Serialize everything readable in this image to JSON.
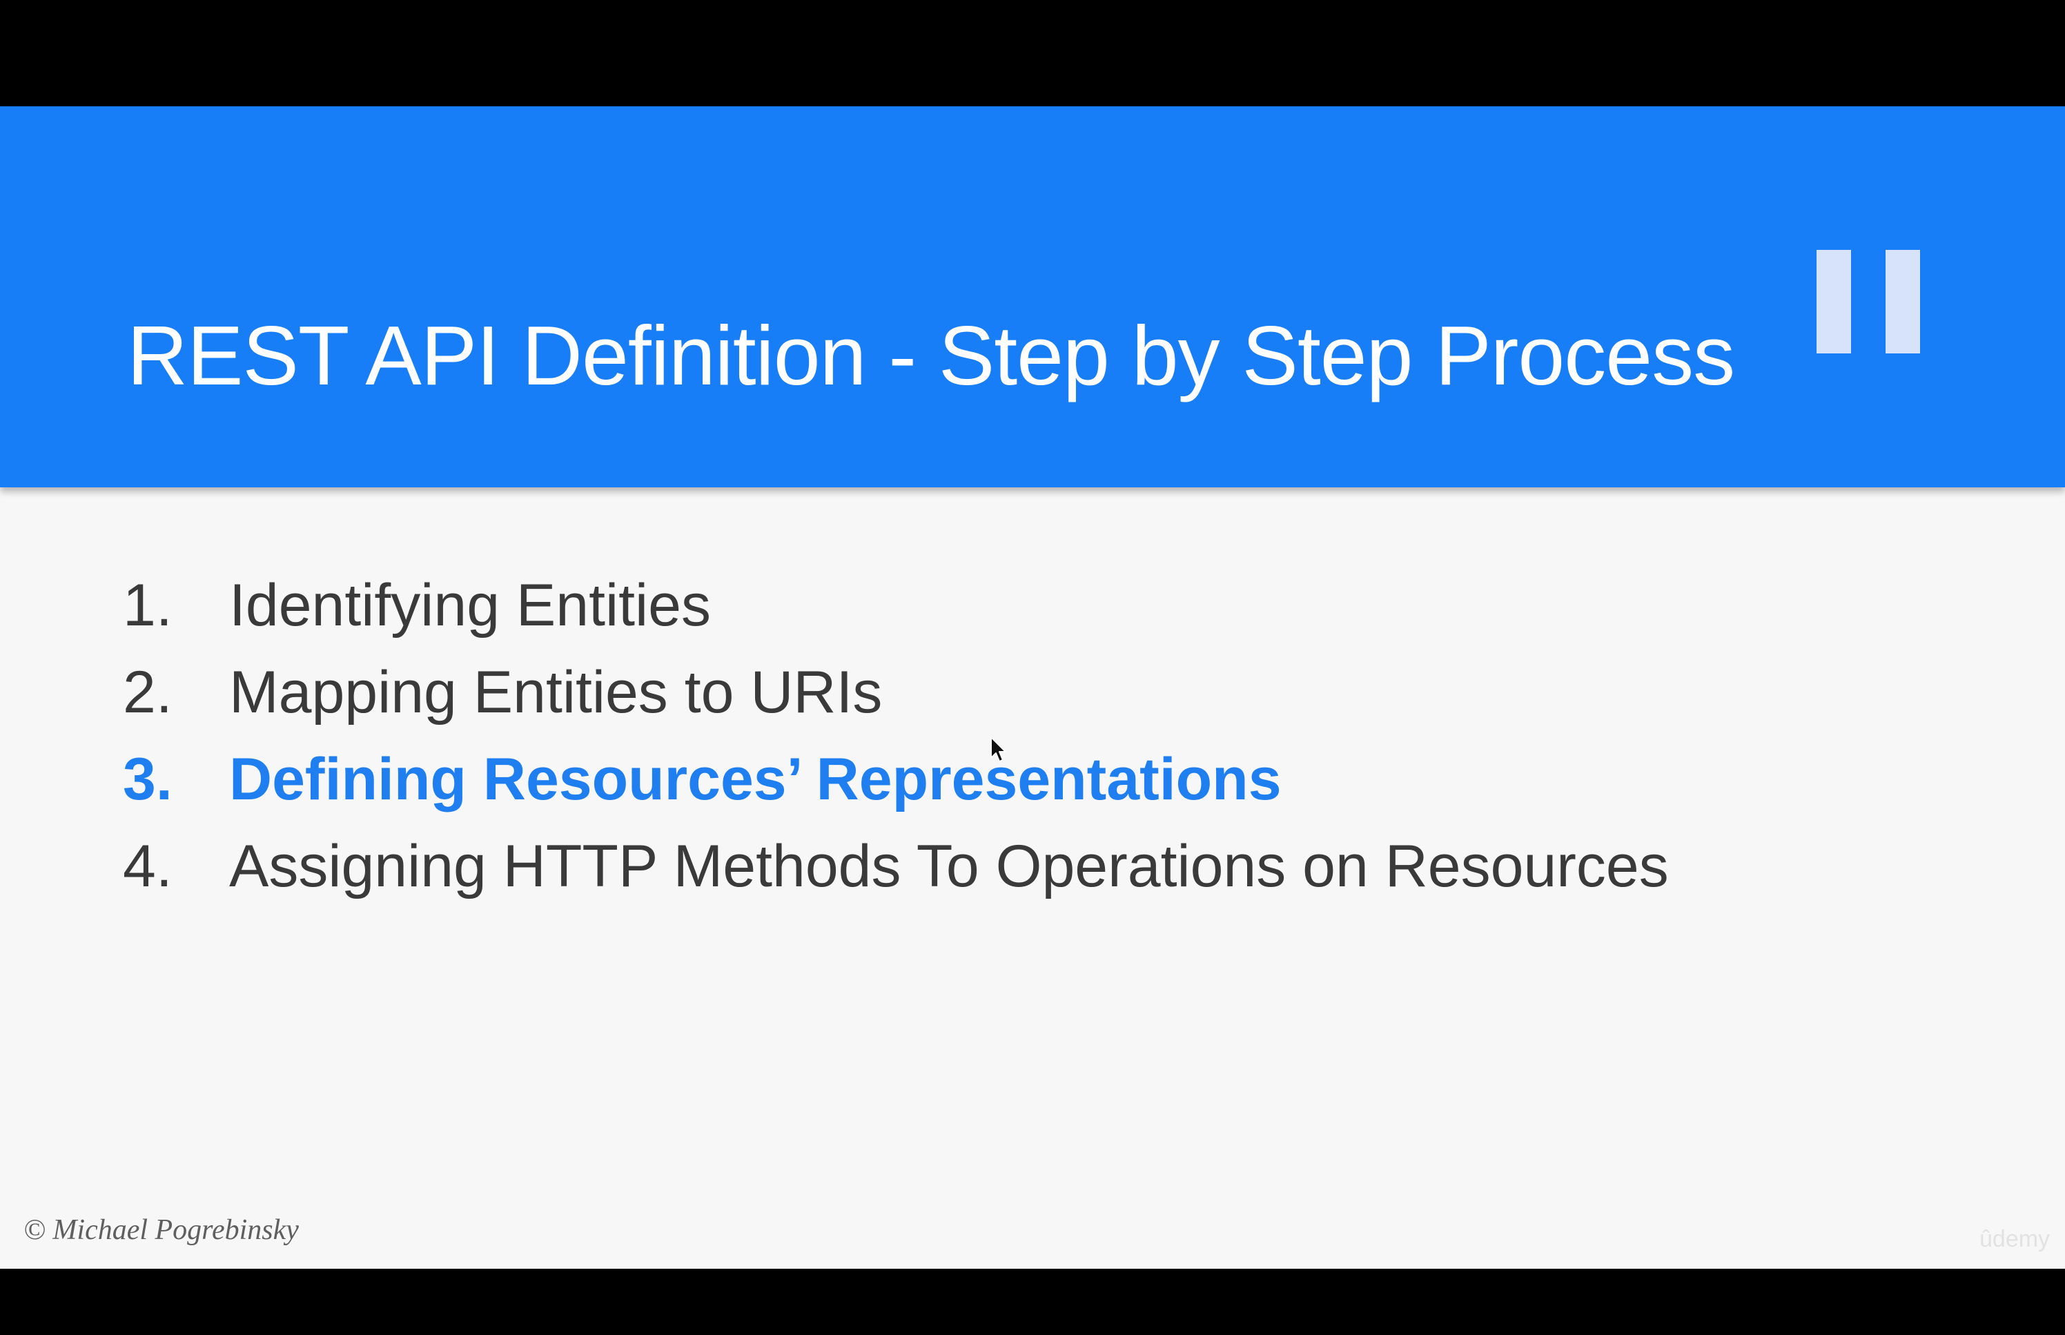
{
  "slide": {
    "title": "REST API Definition - Step by Step Process",
    "steps": [
      {
        "number": "1.",
        "label": "Identifying Entities",
        "active": false
      },
      {
        "number": "2.",
        "label": "Mapping Entities to URIs",
        "active": false
      },
      {
        "number": "3.",
        "label": "Defining Resources’ Representations",
        "active": true
      },
      {
        "number": "4.",
        "label": "Assigning HTTP Methods To Operations on Resources",
        "active": false
      }
    ],
    "copyright": "© Michael Pogrebinsky",
    "watermark": "ûdemy"
  },
  "player": {
    "state_icon": "pause-icon"
  },
  "colors": {
    "header": "#187ef8",
    "active_step": "#1f7ff0",
    "step_text": "#3a3a3a",
    "slide_background": "#f7f7f7",
    "letterbox": "#000000"
  }
}
